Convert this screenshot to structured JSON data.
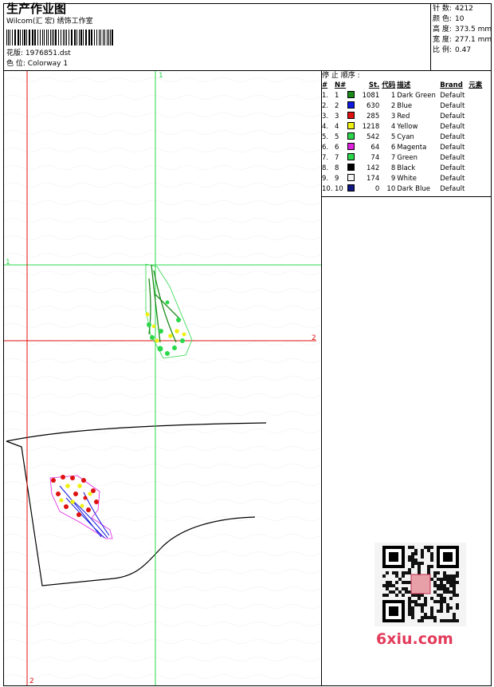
{
  "header": {
    "title": "生产作业图",
    "subtitle": "Wilcom(汇 宏) 绣饰工作室",
    "design_label": "花版:",
    "design_value": "1976851.dst",
    "colorway_label": "色 位:",
    "colorway_value": "Colorway 1"
  },
  "stats": [
    {
      "label": "针 数:",
      "value": "4212"
    },
    {
      "label": "颜 色:",
      "value": "10"
    },
    {
      "label": "高 度:",
      "value": "373.5 mm"
    },
    {
      "label": "宽 度:",
      "value": "277.1 mm"
    },
    {
      "label": "比 例:",
      "value": "0.47"
    }
  ],
  "stop_sequence": {
    "title": "停 止 顺序 :",
    "columns": [
      "#",
      "N#",
      "St.",
      "代码",
      "描述",
      "Brand",
      "元素"
    ],
    "rows": [
      {
        "idx": "1.",
        "n": "1",
        "color": "#1a8a1a",
        "st": "1081",
        "code": "1",
        "desc": "Dark Green",
        "brand": "Default"
      },
      {
        "idx": "2.",
        "n": "2",
        "color": "#1018e0",
        "st": "630",
        "code": "2",
        "desc": "Blue",
        "brand": "Default"
      },
      {
        "idx": "3.",
        "n": "3",
        "color": "#e01010",
        "st": "285",
        "code": "3",
        "desc": "Red",
        "brand": "Default"
      },
      {
        "idx": "4.",
        "n": "4",
        "color": "#f0f010",
        "st": "1218",
        "code": "4",
        "desc": "Yellow",
        "brand": "Default"
      },
      {
        "idx": "5.",
        "n": "5",
        "color": "#2ad84a",
        "st": "542",
        "code": "5",
        "desc": "Cyan",
        "brand": "Default"
      },
      {
        "idx": "6.",
        "n": "6",
        "color": "#e020e0",
        "st": "64",
        "code": "6",
        "desc": "Magenta",
        "brand": "Default"
      },
      {
        "idx": "7.",
        "n": "7",
        "color": "#2ad84a",
        "st": "74",
        "code": "7",
        "desc": "Green",
        "brand": "Default"
      },
      {
        "idx": "8.",
        "n": "8",
        "color": "#000000",
        "st": "142",
        "code": "8",
        "desc": "Black",
        "brand": "Default"
      },
      {
        "idx": "9.",
        "n": "9",
        "color": "#f4f4f4",
        "st": "174",
        "code": "9",
        "desc": "White",
        "brand": "Default"
      },
      {
        "idx": "10.",
        "n": "10",
        "color": "#101880",
        "st": "0",
        "code": "10",
        "desc": "Dark Blue",
        "brand": "Default"
      }
    ]
  },
  "guides": {
    "v_green_label": "1",
    "h_green_label": "1",
    "h_red_label": "2",
    "v_red_label": "2"
  },
  "watermark": "6xiu.com",
  "colors": {
    "guide_green": "#2ad84a",
    "guide_red": "#e01010"
  }
}
